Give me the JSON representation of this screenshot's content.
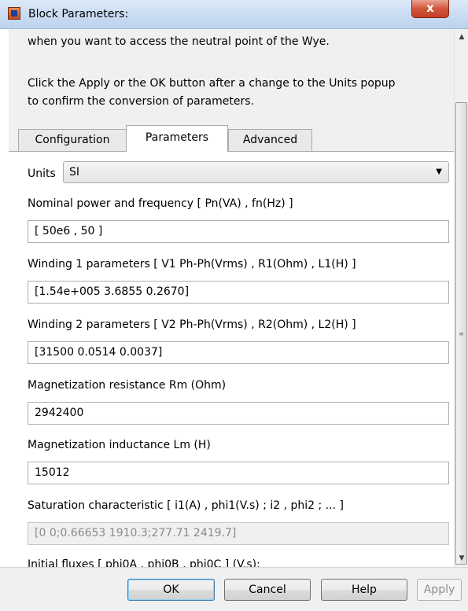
{
  "window": {
    "title": "Block Parameters:",
    "close_glyph": "x",
    "app_icon": "simulink-block-icon"
  },
  "description": {
    "line1": "when you want to access the neutral point of the Wye.",
    "line2": "Click the Apply or the OK button after a change to the Units popup",
    "line3": "to confirm the conversion of parameters."
  },
  "tabs": [
    {
      "label": "Configuration"
    },
    {
      "label": "Parameters"
    },
    {
      "label": "Advanced"
    }
  ],
  "active_tab": "Parameters",
  "units": {
    "label": "Units",
    "value": "SI"
  },
  "fields": {
    "nominal": {
      "label": "Nominal power and frequency  [ Pn(VA) , fn(Hz) ]",
      "value": "[ 50e6 , 50 ]"
    },
    "winding1": {
      "label": "Winding 1 parameters [ V1 Ph-Ph(Vrms) , R1(Ohm) , L1(H) ]",
      "value": "[1.54e+005 3.6855 0.2670]"
    },
    "winding2": {
      "label": "Winding 2 parameters [ V2 Ph-Ph(Vrms) , R2(Ohm) , L2(H) ]",
      "value": "[31500 0.0514 0.0037]"
    },
    "rm": {
      "label": "Magnetization resistance  Rm (Ohm)",
      "value": "2942400"
    },
    "lm": {
      "label": "Magnetization inductance  Lm (H)",
      "value": "15012"
    },
    "saturation": {
      "label": "Saturation characteristic [ i1(A) ,  phi1(V.s) ;  i2 , phi2 ; ... ]",
      "value": "[0 0;0.66653 1910.3;277.71 2419.7]"
    },
    "fluxes": {
      "label": "Initial fluxes [ phi0A , phi0B , phi0C ] (V.s):"
    }
  },
  "buttons": {
    "ok": "OK",
    "cancel": "Cancel",
    "help": "Help",
    "apply": "Apply"
  },
  "colors": {
    "titlebar": "#c9dcf2",
    "close_button": "#c43e26",
    "dialog_bg": "#f0f0f0",
    "default_button_border": "#3c7fb1"
  }
}
